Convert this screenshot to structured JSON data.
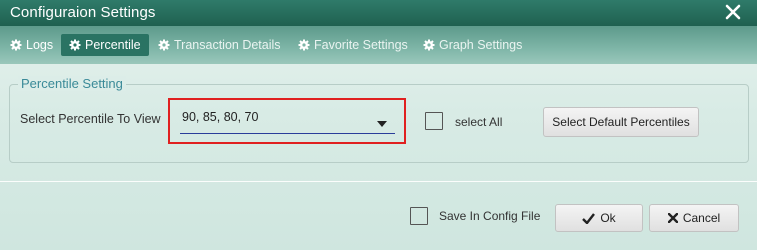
{
  "window": {
    "title": "Configuraion Settings",
    "close_icon": "close-icon"
  },
  "tabs": [
    {
      "label": "Logs",
      "icon": "gear-icon",
      "active": false
    },
    {
      "label": "Percentile",
      "icon": "gear-icon",
      "active": true
    },
    {
      "label": "Transaction Details",
      "icon": "gear-icon",
      "active": false
    },
    {
      "label": "Favorite Settings",
      "icon": "gear-icon",
      "active": false
    },
    {
      "label": "Graph Settings",
      "icon": "gear-icon",
      "active": false
    }
  ],
  "percentile_setting": {
    "legend": "Percentile Setting",
    "select_label": "Select Percentile To View",
    "selected_value": "90, 85, 80, 70",
    "select_all_label": "select All",
    "select_all_checked": false,
    "default_button_label": "Select Default Percentiles"
  },
  "footer": {
    "save_config_label": "Save In Config File",
    "save_config_checked": false,
    "ok_label": "Ok",
    "cancel_label": "Cancel"
  },
  "colors": {
    "titlebar": "#1f6050",
    "active_tab": "#2a7363",
    "legend_text": "#3a8a98",
    "highlight_box": "#e02020",
    "dropdown_underline": "#2a3d9a"
  }
}
